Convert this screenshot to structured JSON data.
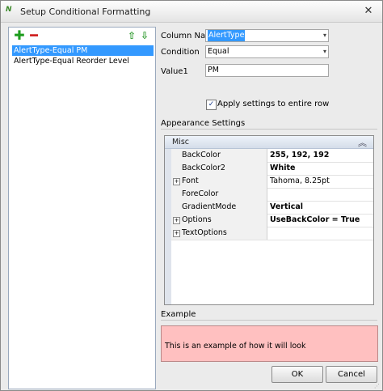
{
  "window": {
    "title": "Setup Conditional Formatting",
    "close_glyph": "✕"
  },
  "toolbar": {
    "add_glyph": "✚",
    "remove_glyph": "━",
    "up_glyph": "⇧",
    "down_glyph": "⇩"
  },
  "rules": [
    {
      "label": "AlertType-Equal PM",
      "selected": true
    },
    {
      "label": "AlertType-Equal Reorder Level",
      "selected": false
    }
  ],
  "form": {
    "column_name_label": "Column Name",
    "column_name_value": "AlertType",
    "condition_label": "Condition",
    "condition_value": "Equal",
    "value1_label": "Value1",
    "value1_value": "PM",
    "apply_row_label": "Apply settings to entire row",
    "apply_row_checked": true
  },
  "appearance": {
    "title": "Appearance Settings",
    "category": "Misc",
    "properties": [
      {
        "name": "BackColor",
        "value": "255, 192, 192",
        "bold": true,
        "expandable": false
      },
      {
        "name": "BackColor2",
        "value": "White",
        "bold": true,
        "expandable": false
      },
      {
        "name": "Font",
        "value": "Tahoma, 8.25pt",
        "bold": false,
        "expandable": true
      },
      {
        "name": "ForeColor",
        "value": "",
        "bold": false,
        "expandable": false
      },
      {
        "name": "GradientMode",
        "value": "Vertical",
        "bold": true,
        "expandable": false
      },
      {
        "name": "Options",
        "value": "UseBackColor = True",
        "bold": true,
        "expandable": true
      },
      {
        "name": "TextOptions",
        "value": "",
        "bold": false,
        "expandable": true
      }
    ]
  },
  "example": {
    "title": "Example",
    "text": "This is an example of how it will look",
    "back_color": "#ffc0c0"
  },
  "buttons": {
    "ok": "OK",
    "cancel": "Cancel"
  }
}
